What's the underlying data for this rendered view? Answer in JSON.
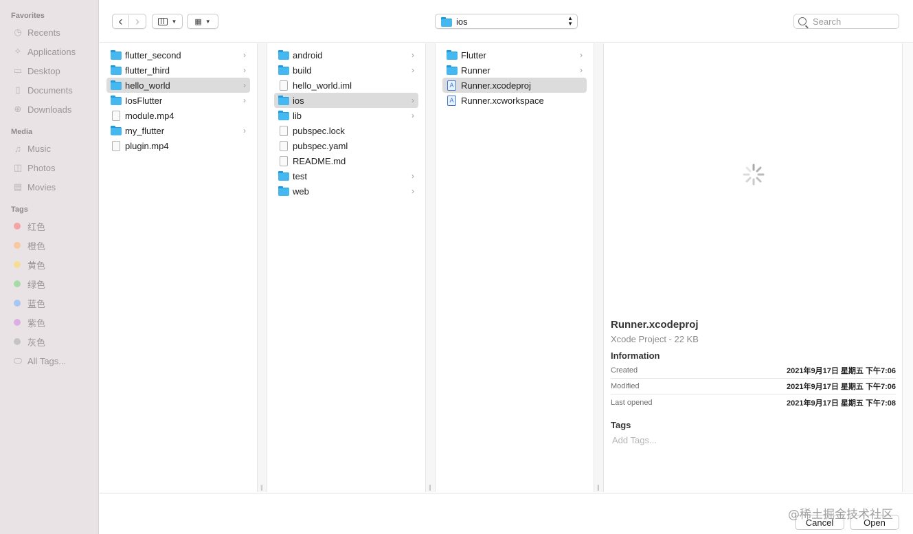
{
  "sidebar": {
    "favorites_label": "Favorites",
    "favorites": [
      {
        "label": "Recents",
        "icon": "clock-icon",
        "glyph": "◷"
      },
      {
        "label": "Applications",
        "icon": "applications-icon",
        "glyph": "✧"
      },
      {
        "label": "Desktop",
        "icon": "desktop-icon",
        "glyph": "▭"
      },
      {
        "label": "Documents",
        "icon": "document-icon",
        "glyph": "▯"
      },
      {
        "label": "Downloads",
        "icon": "download-icon",
        "glyph": "⊕"
      }
    ],
    "media_label": "Media",
    "media": [
      {
        "label": "Music",
        "icon": "music-icon",
        "glyph": "♫"
      },
      {
        "label": "Photos",
        "icon": "photos-icon",
        "glyph": "◫"
      },
      {
        "label": "Movies",
        "icon": "movies-icon",
        "glyph": "▤"
      }
    ],
    "tags_label": "Tags",
    "tags": [
      {
        "label": "红色",
        "color": "#f4a4a4"
      },
      {
        "label": "橙色",
        "color": "#f8c8a0"
      },
      {
        "label": "黄色",
        "color": "#f5dd96"
      },
      {
        "label": "绿色",
        "color": "#a6dba8"
      },
      {
        "label": "蓝色",
        "color": "#a6c6f4"
      },
      {
        "label": "紫色",
        "color": "#dcaee4"
      },
      {
        "label": "灰色",
        "color": "#c4c4c4"
      }
    ],
    "all_tags": "All Tags..."
  },
  "toolbar": {
    "back_glyph": "‹",
    "forward_glyph": "›",
    "path_label": "ios",
    "search_placeholder": "Search"
  },
  "columns": [
    {
      "items": [
        {
          "label": "flutter_second",
          "type": "folder",
          "chev": true,
          "selected": false
        },
        {
          "label": "flutter_third",
          "type": "folder",
          "chev": true,
          "selected": false
        },
        {
          "label": "hello_world",
          "type": "folder",
          "chev": true,
          "selected": true
        },
        {
          "label": "IosFlutter",
          "type": "folder",
          "chev": true,
          "selected": false
        },
        {
          "label": "module.mp4",
          "type": "file",
          "chev": false,
          "selected": false
        },
        {
          "label": "my_flutter",
          "type": "folder",
          "chev": true,
          "selected": false
        },
        {
          "label": "plugin.mp4",
          "type": "file",
          "chev": false,
          "selected": false
        }
      ]
    },
    {
      "items": [
        {
          "label": "android",
          "type": "folder",
          "chev": true,
          "selected": false
        },
        {
          "label": "build",
          "type": "folder",
          "chev": true,
          "selected": false
        },
        {
          "label": "hello_world.iml",
          "type": "file",
          "chev": false,
          "selected": false
        },
        {
          "label": "ios",
          "type": "folder",
          "chev": true,
          "selected": true
        },
        {
          "label": "lib",
          "type": "folder",
          "chev": true,
          "selected": false
        },
        {
          "label": "pubspec.lock",
          "type": "file",
          "chev": false,
          "selected": false
        },
        {
          "label": "pubspec.yaml",
          "type": "file",
          "chev": false,
          "selected": false
        },
        {
          "label": "README.md",
          "type": "file",
          "chev": false,
          "selected": false
        },
        {
          "label": "test",
          "type": "folder",
          "chev": true,
          "selected": false
        },
        {
          "label": "web",
          "type": "folder",
          "chev": true,
          "selected": false
        }
      ]
    },
    {
      "items": [
        {
          "label": "Flutter",
          "type": "folder",
          "chev": true,
          "selected": false
        },
        {
          "label": "Runner",
          "type": "folder",
          "chev": true,
          "selected": false
        },
        {
          "label": "Runner.xcodeproj",
          "type": "xcode",
          "chev": false,
          "selected": true
        },
        {
          "label": "Runner.xcworkspace",
          "type": "xcode",
          "chev": false,
          "selected": false
        }
      ]
    }
  ],
  "preview": {
    "title": "Runner.xcodeproj",
    "subtitle": "Xcode Project - 22 KB",
    "info_label": "Information",
    "info": [
      {
        "key": "Created",
        "value": "2021年9月17日 星期五 下午7:06"
      },
      {
        "key": "Modified",
        "value": "2021年9月17日 星期五 下午7:06"
      },
      {
        "key": "Last opened",
        "value": "2021年9月17日 星期五 下午7:08"
      }
    ],
    "tags_label": "Tags",
    "tags_placeholder": "Add Tags..."
  },
  "footer": {
    "cancel_label": "Cancel",
    "open_label": "Open",
    "watermark": "@稀土掘金技术社区"
  }
}
